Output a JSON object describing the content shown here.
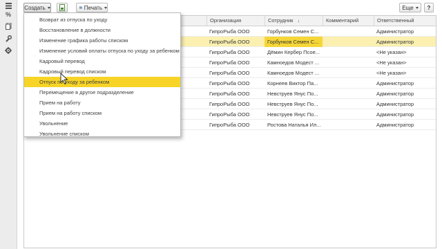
{
  "sidebar": {
    "icons": [
      "menu-icon",
      "percent-icon",
      "documents-icon",
      "wrench-icon",
      "gear-icon"
    ],
    "percent_glyph": "%"
  },
  "toolbar": {
    "create_label": "Создать",
    "print_label": "Печать",
    "more_label": "Еще",
    "help_label": "?"
  },
  "menu": {
    "items": [
      "Возврат из отпуска по уходу",
      "Восстановление в должности",
      "Изменение графика работы списком",
      "Изменение условий оплаты отпуска по уходу за ребенком",
      "Кадровый перевод",
      "Кадровый перевод списком",
      "Отпуск по уходу за ребенком",
      "Перемещение в другое подразделение",
      "Прием на работу",
      "Прием на работу списком",
      "Увольнение",
      "Увольнение списком"
    ],
    "highlighted_index": 6,
    "highlight_color": "#f7d426"
  },
  "table": {
    "columns": [
      "Организация",
      "Сотрудник",
      "Комментарий",
      "Ответственный"
    ],
    "sort_indicator": "↓",
    "rows": [
      {
        "org": "ГипроРыба ООО",
        "employee": "Горбунков Семен С...",
        "comment": "",
        "responsible": "Администратор"
      },
      {
        "org": "ГипроРыба ООО",
        "employee": "Горбунков Семен С...",
        "comment": "",
        "responsible": "Администратор"
      },
      {
        "org": "ГипроРыба ООО",
        "employee": "Дёмин Кербер Псое...",
        "comment": "",
        "responsible": "<Не указан>"
      },
      {
        "org": "ГипроРыба ООО",
        "employee": "Камноедов Модест ...",
        "comment": "",
        "responsible": "<Не указан>"
      },
      {
        "org": "ГипроРыба ООО",
        "employee": "Камноедов Модест ...",
        "comment": "",
        "responsible": "<Не указан>"
      },
      {
        "org": "ГипроРыба ООО",
        "employee": "Корнеев Виктор Па...",
        "comment": "",
        "responsible": "Администратор"
      },
      {
        "org": "ГипроРыба ООО",
        "employee": "Невструев Янус По...",
        "comment": "",
        "responsible": "Администратор"
      },
      {
        "org": "ГипроРыба ООО",
        "employee": "Невструев Янус По...",
        "comment": "",
        "responsible": "Администратор"
      },
      {
        "org": "ГипроРыба ООО",
        "employee": "Невструев Янус По...",
        "comment": "",
        "responsible": "Администратор"
      },
      {
        "org": "ГипроРыба ООО",
        "employee": "Ростова Наталья Ил...",
        "comment": "",
        "responsible": "Администратор"
      }
    ],
    "selected_row": 1,
    "selected_row_color": "#fbf0b0",
    "current_cell_color": "#f6d637"
  }
}
